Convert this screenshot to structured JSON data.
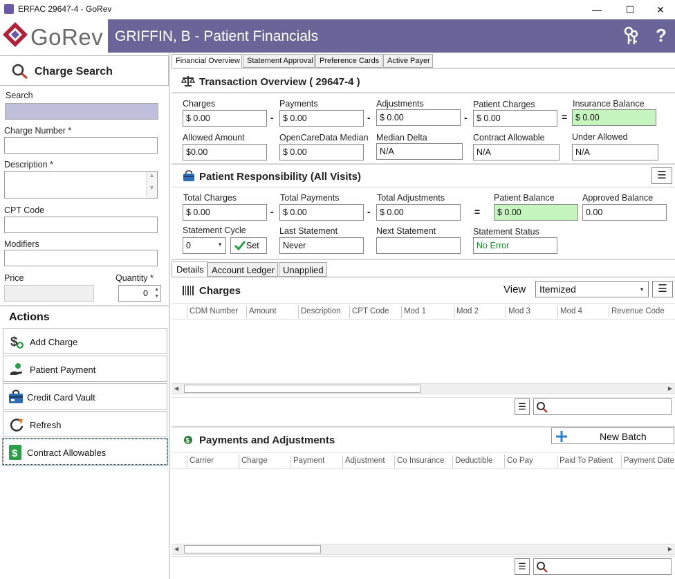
{
  "window": {
    "title": "ERFAC 29647-4 - GoRev",
    "minimize": "—",
    "maximize": "☐",
    "close": "✕"
  },
  "header": {
    "logo": "GoRev",
    "title": "GRIFFIN, B - Patient Financials",
    "help": "?"
  },
  "sidebar": {
    "section_title": "Charge Search",
    "search_label": "Search",
    "search_value": "",
    "charge_number_label": "Charge Number *",
    "description_label": "Description *",
    "cpt_label": "CPT Code",
    "modifiers_label": "Modifiers",
    "price_label": "Price",
    "quantity_label": "Quantity *",
    "quantity_value": "0",
    "actions_title": "Actions",
    "actions": [
      "Add Charge",
      "Patient Payment",
      "Credit Card Vault",
      "Refresh",
      "Contract Allowables"
    ]
  },
  "tabs": [
    "Financial Overview",
    "Statement Approval",
    "Preference Cards",
    "Active Payer"
  ],
  "transaction": {
    "title": "Transaction Overview ( 29647-4 )",
    "charges_label": "Charges",
    "charges": "$ 0.00",
    "payments_label": "Payments",
    "payments": "$ 0.00",
    "adjustments_label": "Adjustments",
    "adjustments": "$ 0.00",
    "patient_charges_label": "Patient Charges",
    "patient_charges": "$ 0.00",
    "insurance_balance_label": "Insurance Balance",
    "insurance_balance": "$ 0.00",
    "allowed_amount_label": "Allowed Amount",
    "allowed_amount": "$0.00",
    "ocd_median_label": "OpenCareData Median",
    "ocd_median": "$ 0.00",
    "median_delta_label": "Median Delta",
    "median_delta": "N/A",
    "contract_allowable_label": "Contract Allowable",
    "contract_allowable": "N/A",
    "under_allowed_label": "Under Allowed",
    "under_allowed": "N/A",
    "minus": "-",
    "equals": "="
  },
  "patient": {
    "title": "Patient Responsibility (All Visits)",
    "total_charges_label": "Total Charges",
    "total_charges": "$ 0.00",
    "total_payments_label": "Total Payments",
    "total_payments": "$ 0.00",
    "total_adjustments_label": "Total Adjustments",
    "total_adjustments": "$ 0.00",
    "patient_balance_label": "Patient Balance",
    "patient_balance": "$ 0.00",
    "approved_balance_label": "Approved Balance",
    "approved_balance": "0.00",
    "statement_cycle_label": "Statement Cycle",
    "statement_cycle": "0",
    "set_label": "Set",
    "last_statement_label": "Last Statement",
    "last_statement": "Never",
    "next_statement_label": "Next Statement",
    "next_statement": "",
    "statement_status_label": "Statement Status",
    "statement_status": "No Error"
  },
  "tabs2": [
    "Details",
    "Account Ledger",
    "Unapplied"
  ],
  "charges": {
    "title": "Charges",
    "view_label": "View",
    "view_value": "Itemized",
    "columns": [
      "CDM Number",
      "Amount",
      "Description",
      "CPT Code",
      "Mod 1",
      "Mod 2",
      "Mod 3",
      "Mod 4",
      "Revenue Code"
    ]
  },
  "payments": {
    "title": "Payments and Adjustments",
    "new_batch": "New Batch",
    "columns": [
      "Carrier",
      "Charge",
      "Payment",
      "Adjustment",
      "Co Insurance",
      "Deductible",
      "Co Pay",
      "Paid To Patient",
      "Payment Date"
    ]
  },
  "colors": {
    "header": "#6b6499",
    "green": "#c7f5c0",
    "logo_red": "#b2203a",
    "logo_purple": "#6b5aa6"
  }
}
